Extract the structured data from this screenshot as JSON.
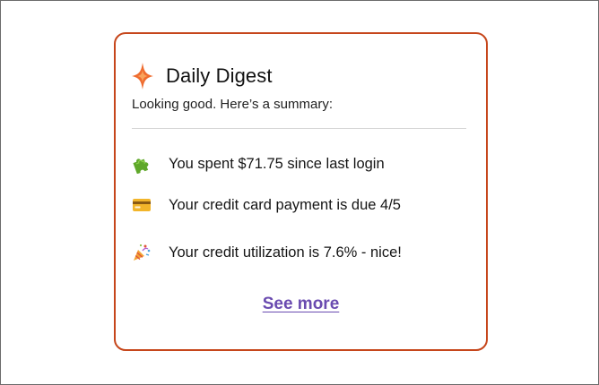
{
  "colors": {
    "card_border": "#c6461b",
    "accent": "#ef6c2f",
    "link": "#6a4bb0",
    "divider": "#d6d6d6"
  },
  "card": {
    "icon": "sparkle-icon",
    "title": "Daily Digest",
    "subtitle": "Looking good. Here’s a summary:",
    "items": [
      {
        "icon": "puzzle-piece-icon",
        "text": "You spent $71.75 since last login"
      },
      {
        "icon": "credit-card-icon",
        "text": "Your credit card payment is due 4/5"
      },
      {
        "icon": "party-popper-icon",
        "text": "Your credit utilization is 7.6% - nice!"
      }
    ],
    "see_more_label": "See more"
  }
}
